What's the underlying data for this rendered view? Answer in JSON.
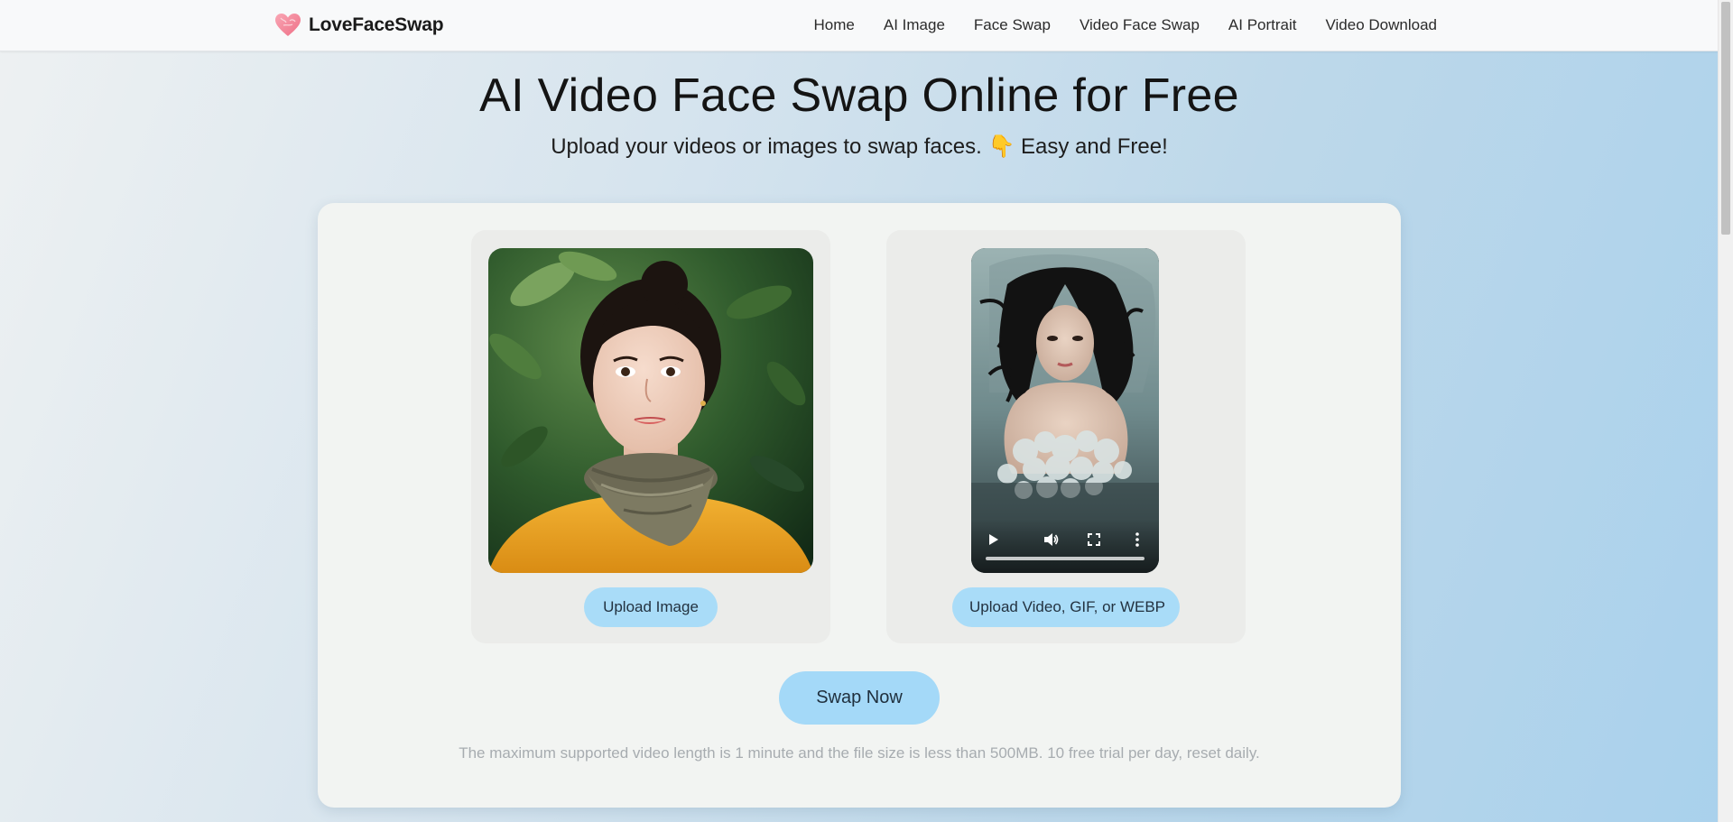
{
  "navbar": {
    "brand": "LoveFaceSwap",
    "brand_icon": "heart-icon",
    "links": [
      "Home",
      "AI Image",
      "Face Swap",
      "Video Face Swap",
      "AI Portrait",
      "Video Download"
    ]
  },
  "hero": {
    "title": "AI Video Face Swap Online for Free",
    "subtitle": "Upload your videos or images to swap faces. 👇 Easy and Free!"
  },
  "upload": {
    "image_button": "Upload Image",
    "video_button": "Upload Video, GIF, or WEBP"
  },
  "video_player": {
    "controls": [
      "play-icon",
      "volume-icon",
      "fullscreen-icon",
      "more-options-icon"
    ]
  },
  "swap_button": "Swap Now",
  "note": "The maximum supported video length is 1 minute and the file size is less than 500MB. 10 free trial per day, reset daily.",
  "colors": {
    "button_bg": "#a9dcf8",
    "card_bg": "#f2f4f2",
    "panel_bg": "#ebecea"
  }
}
